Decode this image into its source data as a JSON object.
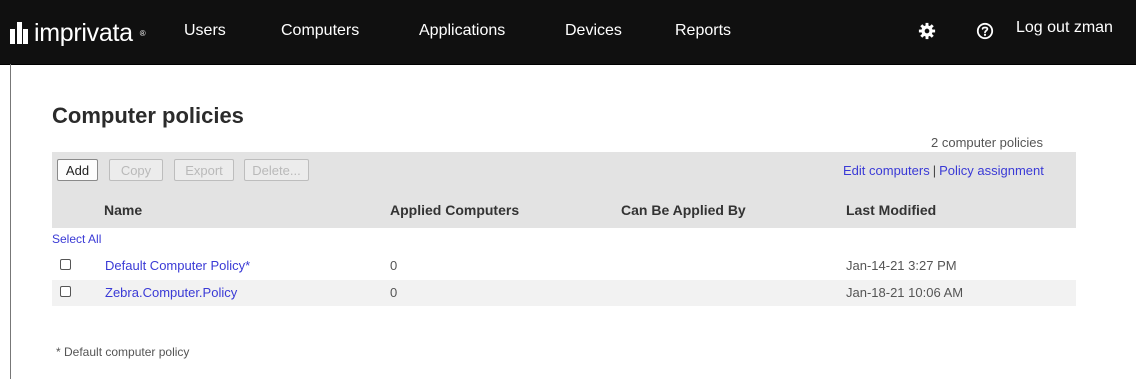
{
  "nav": {
    "brand": "imprivata",
    "brand_tm": "®",
    "items": [
      {
        "label": "Users"
      },
      {
        "label": "Computers"
      },
      {
        "label": "Applications"
      },
      {
        "label": "Devices"
      },
      {
        "label": "Reports"
      }
    ],
    "icons": [
      "gear-icon",
      "help-icon"
    ],
    "logout_label": "Log out zman"
  },
  "page": {
    "title": "Computer policies",
    "count_text": "2 computer policies"
  },
  "toolbar": {
    "buttons": [
      {
        "label": "Add",
        "enabled": true
      },
      {
        "label": "Copy",
        "enabled": false
      },
      {
        "label": "Export",
        "enabled": false
      },
      {
        "label": "Delete...",
        "enabled": false
      }
    ],
    "links": [
      {
        "label": "Edit computers"
      },
      {
        "label": "Policy assignment"
      }
    ],
    "link_separator": "|"
  },
  "table": {
    "columns": [
      "Name",
      "Applied Computers",
      "Can Be Applied By",
      "Last Modified"
    ],
    "select_all": "Select All",
    "rows": [
      {
        "name": "Default Computer Policy*",
        "applied": "0",
        "applied_by": "",
        "modified": "Jan-14-21 3:27 PM"
      },
      {
        "name": "Zebra.Computer.Policy",
        "applied": "0",
        "applied_by": "",
        "modified": "Jan-18-21 10:06 AM"
      }
    ]
  },
  "footnote": "* Default computer policy",
  "colors": {
    "topbar": "#101010",
    "link": "#3a3ad6",
    "band": "#e3e3e3"
  }
}
